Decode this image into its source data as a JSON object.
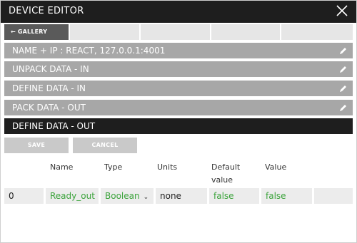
{
  "window": {
    "title": "DEVICE EDITOR"
  },
  "nav": {
    "gallery_label": "← GALLERY"
  },
  "sections": [
    {
      "label": "NAME + IP : REACT, 127.0.0.1:4001"
    },
    {
      "label": "UNPACK DATA - IN"
    },
    {
      "label": "DEFINE DATA - IN"
    },
    {
      "label": "PACK DATA - OUT"
    },
    {
      "label": "DEFINE DATA - OUT"
    }
  ],
  "actions": {
    "save": "SAVE",
    "cancel": "CANCEL"
  },
  "table": {
    "headers": {
      "name": "Name",
      "type": "Type",
      "units": "Units",
      "default_line1": "Default",
      "default_line2": "value",
      "value": "Value"
    },
    "rows": [
      {
        "index": "0",
        "name": "Ready_out",
        "type": "Boolean",
        "units": "none",
        "default": "false",
        "value": "false"
      }
    ]
  },
  "colors": {
    "title_bar": "#1e1e1e",
    "section": "#a7a7a7",
    "active_section": "#1e1e1e",
    "value_text": "#3aa33a"
  }
}
